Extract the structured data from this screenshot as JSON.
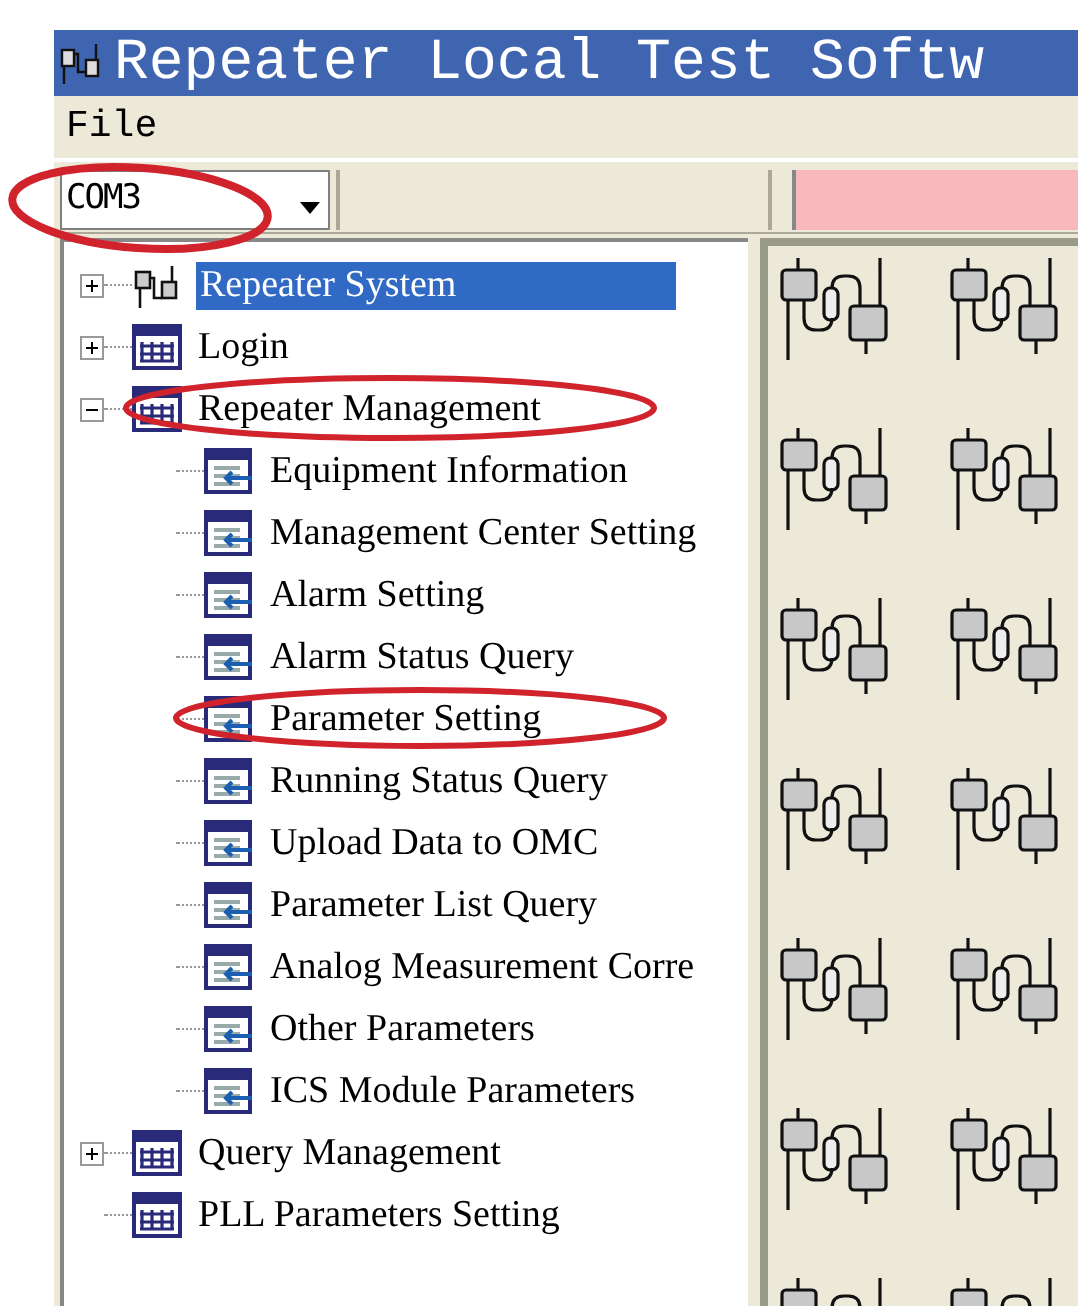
{
  "window": {
    "title": "Repeater Local Test Softw"
  },
  "menu": [
    {
      "label": "File"
    }
  ],
  "toolbar": {
    "port_select": {
      "value": "COM3"
    }
  },
  "tree": [
    {
      "label": "Repeater System",
      "kind": "system",
      "expanded": false,
      "selected": true
    },
    {
      "label": "Login",
      "kind": "folder",
      "expanded": false,
      "selected": false
    },
    {
      "label": "Repeater Management",
      "kind": "folder",
      "expanded": true,
      "selected": false,
      "children": [
        {
          "label": "Equipment Information",
          "kind": "page",
          "selected": false
        },
        {
          "label": "Management Center Setting",
          "kind": "page",
          "selected": false
        },
        {
          "label": "Alarm Setting",
          "kind": "page",
          "selected": false
        },
        {
          "label": "Alarm Status Query",
          "kind": "page",
          "selected": false
        },
        {
          "label": "Parameter Setting",
          "kind": "page",
          "selected": false
        },
        {
          "label": "Running Status Query",
          "kind": "page",
          "selected": false
        },
        {
          "label": "Upload Data to OMC",
          "kind": "page",
          "selected": false
        },
        {
          "label": "Parameter List Query",
          "kind": "page",
          "selected": false
        },
        {
          "label": "Analog Measurement Corre",
          "kind": "page",
          "selected": false
        },
        {
          "label": "Other Parameters",
          "kind": "page",
          "selected": false
        },
        {
          "label": "ICS Module Parameters",
          "kind": "page",
          "selected": false
        }
      ]
    },
    {
      "label": "Query Management",
      "kind": "folder",
      "expanded": false,
      "selected": false
    },
    {
      "label": "PLL Parameters Setting",
      "kind": "folder",
      "selected": false
    }
  ]
}
